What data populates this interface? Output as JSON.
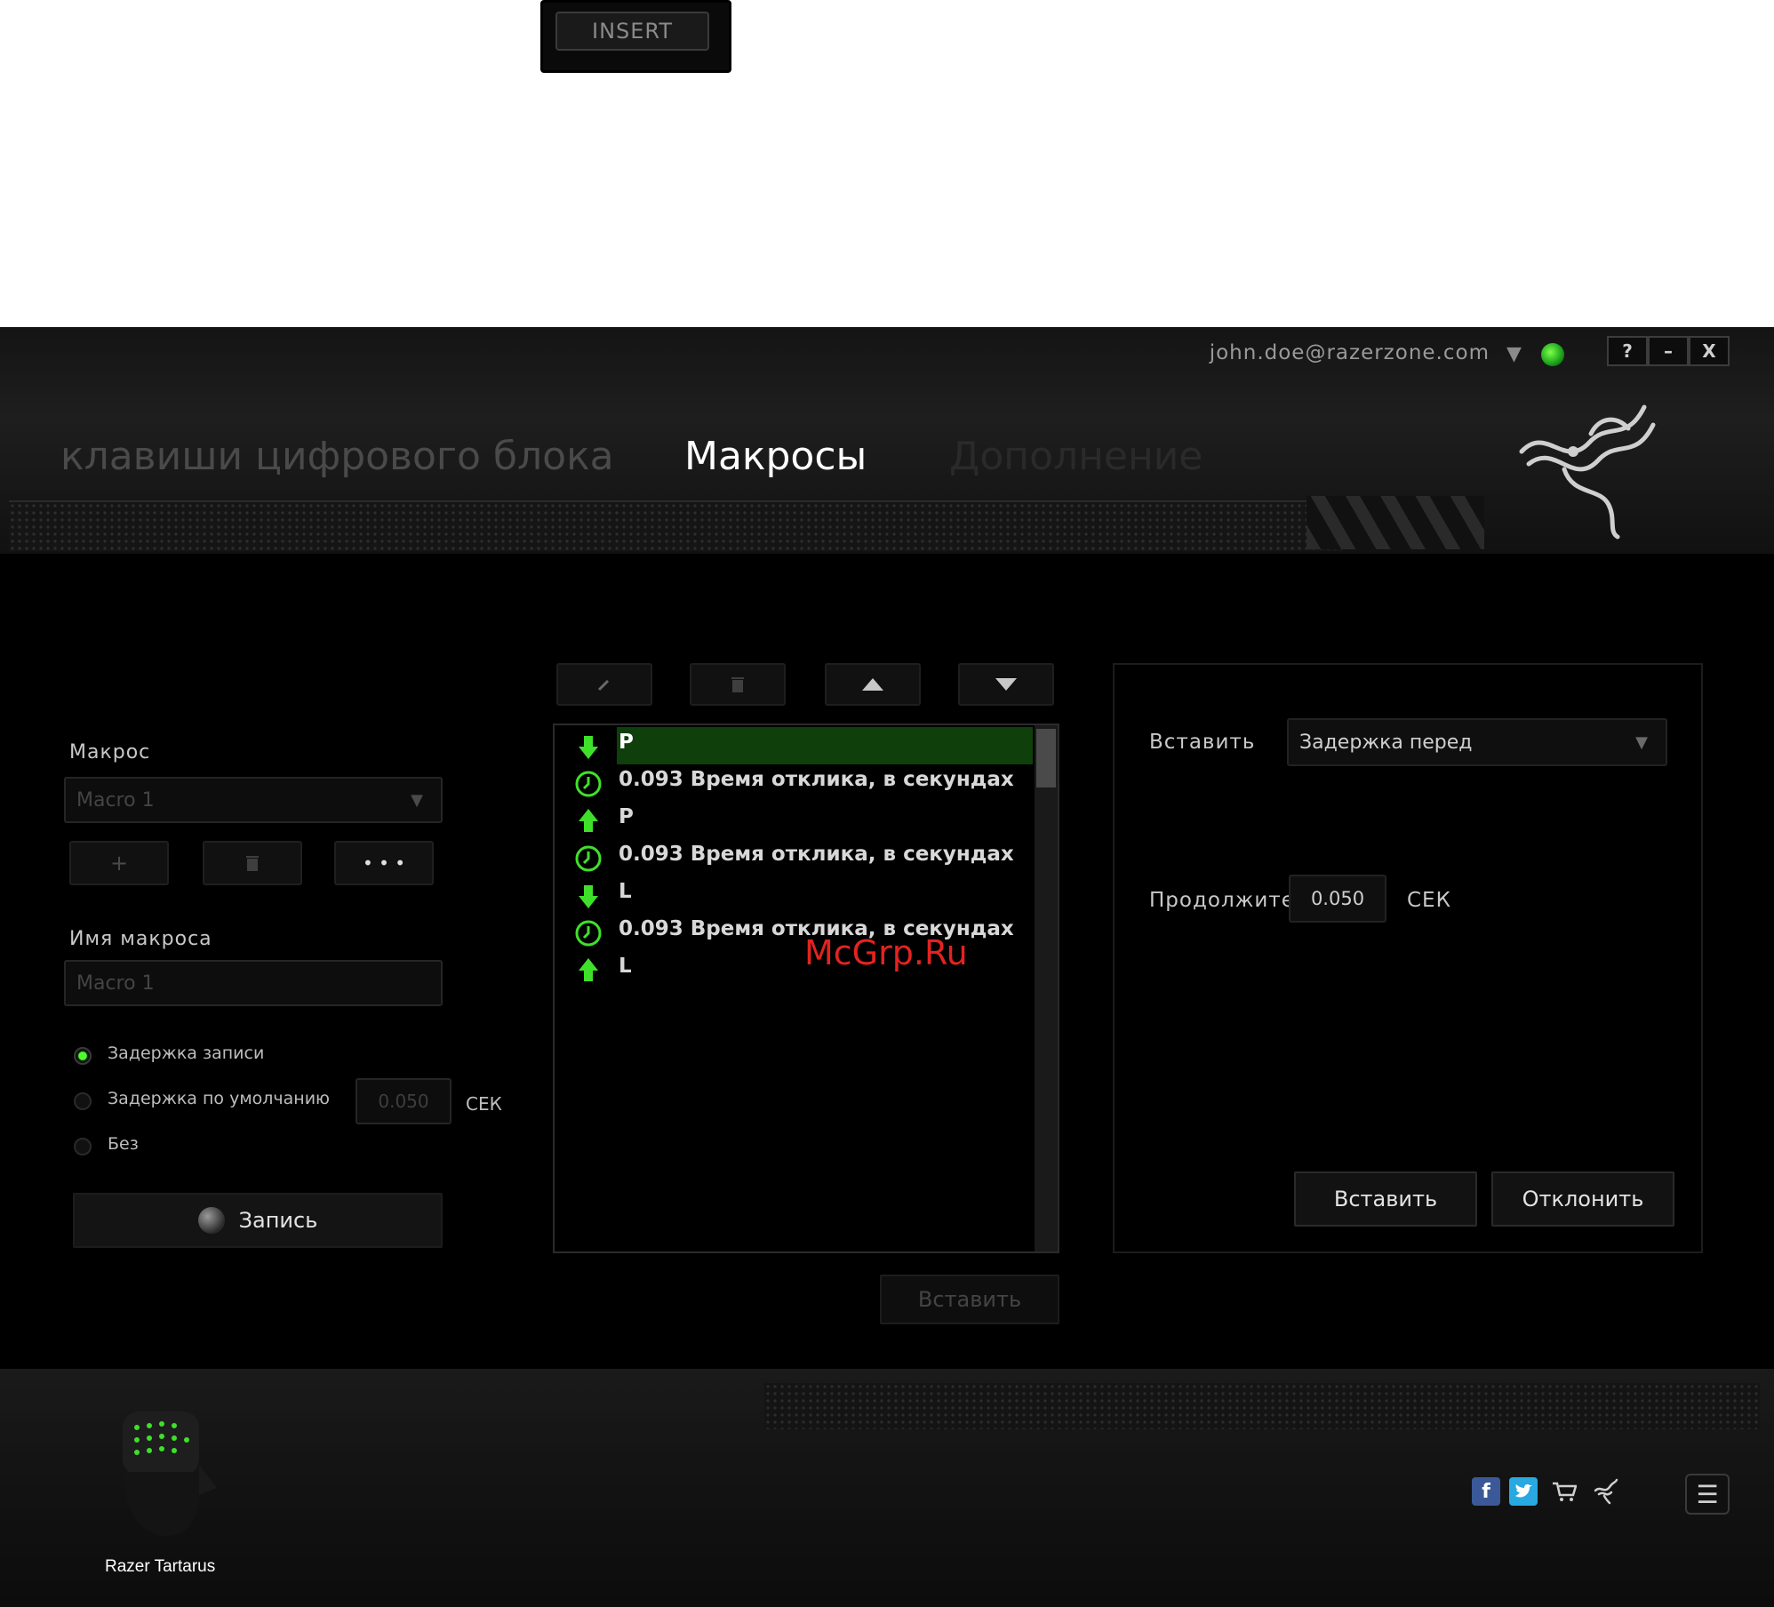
{
  "top_key": {
    "label": "INSERT"
  },
  "window": {
    "account": "john.doe@razerzone.com",
    "buttons": {
      "help": "?",
      "minimize": "–",
      "close": "X"
    },
    "tabs": [
      {
        "label": "клавиши цифрового блока"
      },
      {
        "label": "Макросы"
      },
      {
        "label": "Дополнение"
      }
    ]
  },
  "left": {
    "macro_label": "Макрос",
    "macro_select": "Macro 1",
    "add": "+",
    "more": "• • •",
    "name_label": "Имя макроса",
    "name_value": "Macro 1",
    "radios": [
      {
        "label": "Задержка записи",
        "checked": true
      },
      {
        "label": "Задержка по умолчанию",
        "checked": false
      },
      {
        "label": "Без",
        "checked": false
      }
    ],
    "default_delay": "0.050",
    "unit": "СЕК",
    "record": "Запись"
  },
  "list": {
    "rows": [
      {
        "icon": "key-down-arrow-icon",
        "text": "P"
      },
      {
        "icon": "clock-icon",
        "text": "0.093 Время отклика, в секундах"
      },
      {
        "icon": "key-up-arrow-icon",
        "text": "P"
      },
      {
        "icon": "clock-icon",
        "text": "0.093 Время отклика, в секундах"
      },
      {
        "icon": "key-down-arrow-icon",
        "text": "L"
      },
      {
        "icon": "clock-icon",
        "text": "0.093 Время отклика, в секундах"
      },
      {
        "icon": "key-up-arrow-icon",
        "text": "L"
      }
    ],
    "selected_index": 0,
    "insert_button": "Вставить"
  },
  "right": {
    "insert_label": "Вставить",
    "insert_select": "Задержка перед",
    "duration_label": "Продолжите.",
    "duration_value": "0.050",
    "unit": "СЕК",
    "insert_button": "Вставить",
    "cancel_button": "Отклонить"
  },
  "footer": {
    "device": "Razer Tartarus",
    "menu": "☰"
  },
  "watermark": "McGrp.Ru",
  "colors": {
    "accent": "#44d62c",
    "selection": "#0f3f0a"
  }
}
